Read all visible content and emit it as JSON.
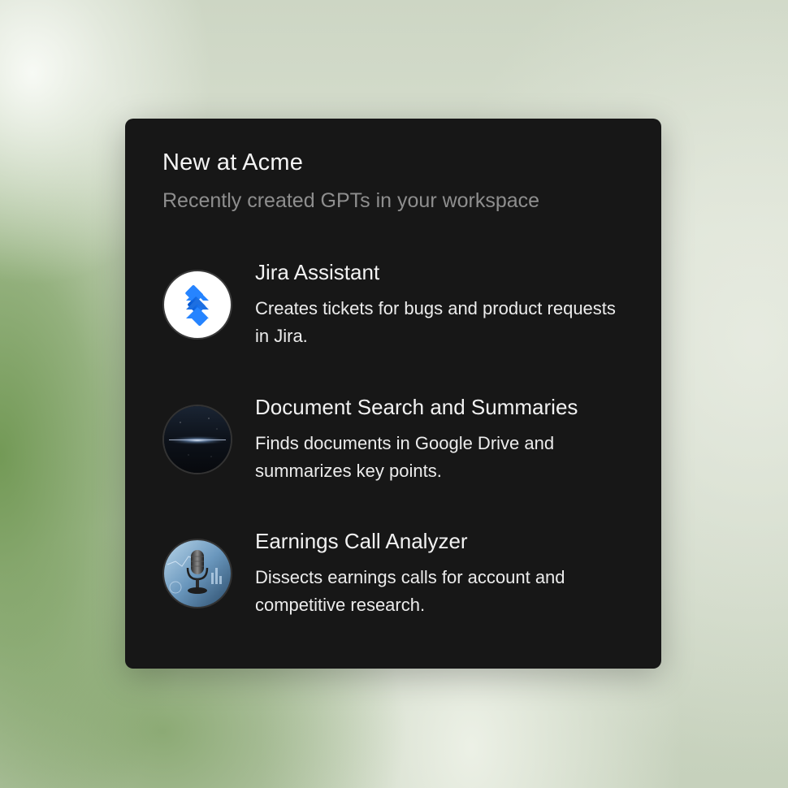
{
  "card": {
    "title": "New at Acme",
    "subtitle": "Recently created GPTs in your workspace"
  },
  "gpts": [
    {
      "name": "Jira Assistant",
      "description": "Creates tickets for bugs and product requests in Jira.",
      "icon": "jira-logo-icon",
      "accent": "#2684FF"
    },
    {
      "name": "Document Search and Summaries",
      "description": "Finds documents in Google Drive and summarizes key points.",
      "icon": "galaxy-horizon-icon"
    },
    {
      "name": "Earnings Call Analyzer",
      "description": "Dissects earnings calls for account and competitive research.",
      "icon": "microphone-icon"
    }
  ],
  "colors": {
    "card_background": "#171717",
    "subtitle_text": "#8e8e8e",
    "primary_text": "#f2f2f2"
  }
}
